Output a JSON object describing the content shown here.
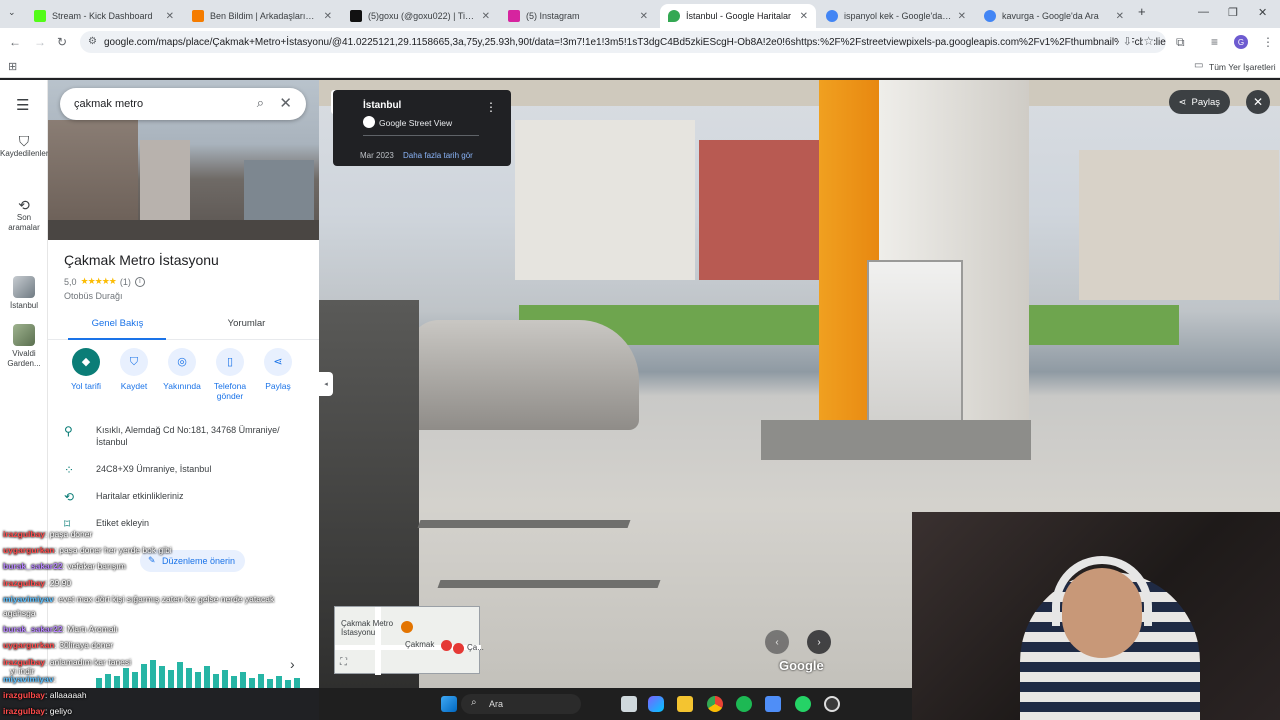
{
  "browser": {
    "tabs": [
      {
        "title": "Stream - Kick Dashboard",
        "color": "#53fc18"
      },
      {
        "title": "Ben Bildim | Arkadaşlarınla Onli",
        "color": "#f57c00"
      },
      {
        "title": "(5)goxu (@goxu022) | TikTok",
        "color": "#000000"
      },
      {
        "title": "(5) Instagram",
        "color": "#d6249f"
      },
      {
        "title": "İstanbul - Google Haritalar",
        "color": "#34a853"
      },
      {
        "title": "ispanyol kek - Google'da Ara",
        "color": "#4285f4"
      },
      {
        "title": "kavurga - Google'da Ara",
        "color": "#4285f4"
      }
    ],
    "url": "google.com/maps/place/Çakmak+Metro+İstasyonu/@41.0225121,29.1158665,3a,75y,25.93h,90t/data=!3m7!1e1!3m5!1sT3dgC4Bd5zkiEScgH-Ob8A!2e0!6shttps:%2F%2Fstreetviewpixels-pa.googleapis.com%2Fv1%2Fthumbnail%3Fcb_client%3D...",
    "bookmarks_label": "Tüm Yer İşaretleri",
    "profile_initial": "G"
  },
  "rail": {
    "saved": "Kaydedilenler",
    "recent": "Son aramalar",
    "istanbul": "İstanbul",
    "vivaldi": "Vivaldi Garden..."
  },
  "panel": {
    "search_value": "çakmak metro",
    "title": "Çakmak Metro İstasyonu",
    "rating": "5,0",
    "stars": "★★★★★",
    "reviews": "(1)",
    "category": "Otobüs Durağı",
    "tabs": [
      "Genel Bakış",
      "Yorumlar"
    ],
    "actions": [
      "Yol tarifi",
      "Kaydet",
      "Yakınında",
      "Telefona gönder",
      "Paylaş"
    ],
    "address": "Kısıklı, Alemdağ Cd No:181, 34768 Ümraniye/ İstanbul",
    "pluscode": "24C8+X9 Ümraniye, İstanbul",
    "maps_activity": "Haritalar etkinlikleriniz",
    "add_label": "Etiket ekleyin",
    "suggest_edit": "Düzenleme önerin"
  },
  "chat": [
    {
      "user": "irazgulbay",
      "msg": ": paşa doner",
      "color": "#ff4b4b"
    },
    {
      "user": "uygargurkan",
      "msg": ": paşa doner her yerde bok gibi",
      "color": "#ff4b4b"
    },
    {
      "user": "burak_sakar22",
      "msg": ": vefakar barışım",
      "color": "#9b59ff"
    },
    {
      "user": "irazgulbay",
      "msg": ": 29.90",
      "color": "#ff4b4b"
    },
    {
      "user": "miyavimiyav",
      "msg": ": evet max dört kişi sığarmış zaten kız gelse nerde yatacak",
      "color": "#5bc0ff"
    },
    {
      "user": "",
      "msg": "agahsga",
      "color": "#ffffff"
    },
    {
      "user": "burak_sakar22",
      "msg": ": Martı Aromalı",
      "color": "#9b59ff"
    },
    {
      "user": "uygargurkan",
      "msg": ": 30liraya doner",
      "color": "#ff4b4b"
    },
    {
      "user": "irazgulbay",
      "msg": ": anlamadım kar tanesi",
      "color": "#ff4b4b"
    },
    {
      "user": "",
      "msg": "yi indir",
      "color": "#ffffff"
    },
    {
      "user": "miyavimiyav",
      "msg": ":",
      "color": "#5bc0ff"
    },
    {
      "user": "irazgulbay",
      "msg": ": allaaaaah",
      "color": "#ff4b4b"
    },
    {
      "user": "irazgulbay",
      "msg": ": geliyo",
      "color": "#ff4b4b"
    }
  ],
  "streetview": {
    "place": "İstanbul",
    "brand": "Google Street View",
    "date": "Mar 2023",
    "more_dates": "Daha fazla tarih gör",
    "share": "Paylaş",
    "google": "Google",
    "minimap_place": "Çakmak Metro İstasyonu",
    "minimap_station": "Çakmak",
    "minimap_extra": "Ça..."
  },
  "taskbar": {
    "search_placeholder": "Ara"
  }
}
